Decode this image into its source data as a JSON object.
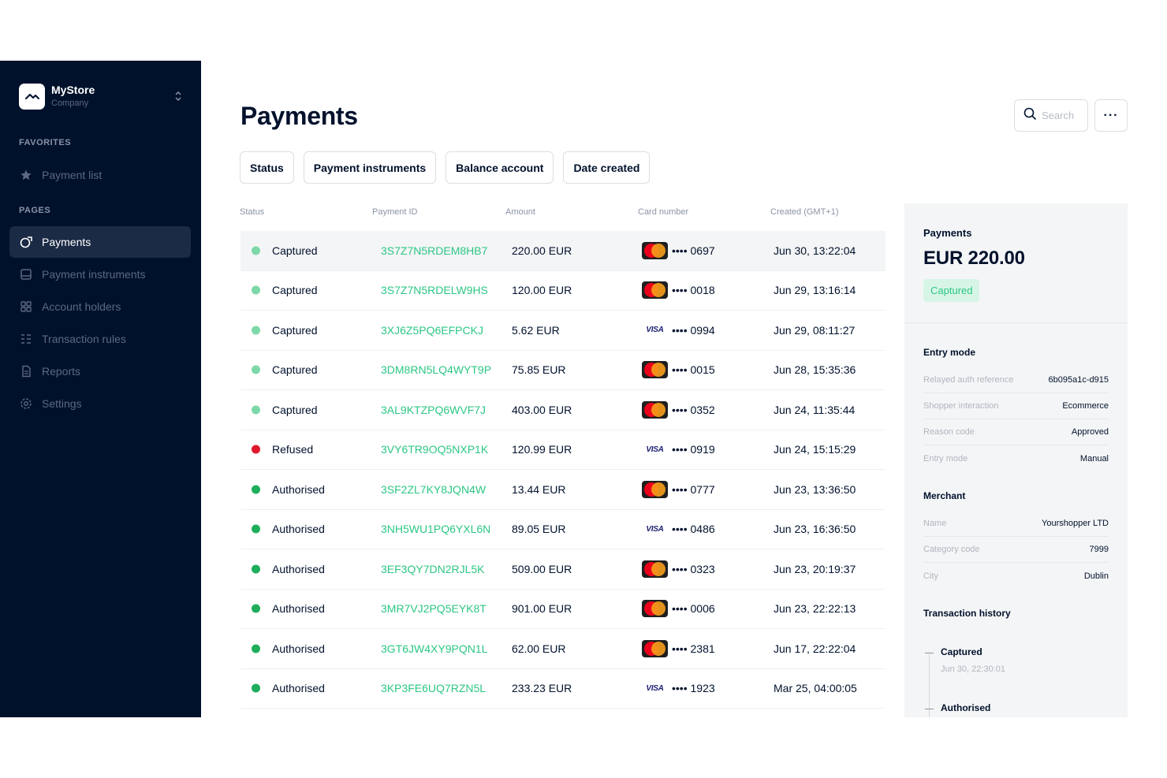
{
  "store": {
    "name": "MyStore",
    "subtitle": "Company"
  },
  "sidebar": {
    "favorites_label": "FAVORITES",
    "favorites": [
      {
        "label": "Payment list",
        "icon": "star-icon"
      }
    ],
    "pages_label": "PAGES",
    "pages": [
      {
        "label": "Payments",
        "icon": "payments-icon",
        "active": true
      },
      {
        "label": "Payment instruments",
        "icon": "card-icon"
      },
      {
        "label": "Account holders",
        "icon": "grid-icon"
      },
      {
        "label": "Transaction rules",
        "icon": "rules-icon"
      },
      {
        "label": "Reports",
        "icon": "document-icon"
      },
      {
        "label": "Settings",
        "icon": "gear-icon"
      }
    ]
  },
  "header": {
    "title": "Payments",
    "search_placeholder": "Search",
    "more_label": "···"
  },
  "filters": [
    "Status",
    "Payment instruments",
    "Balance account",
    "Date created"
  ],
  "table": {
    "columns": [
      "Status",
      "Payment ID",
      "Amount",
      "Card number",
      "Created (GMT+1)"
    ],
    "rows": [
      {
        "status": "Captured",
        "id": "3S7Z7N5RDEM8HB7",
        "amount": "220.00 EUR",
        "brand": "mastercard",
        "card": "•••• 0697",
        "created": "Jun 30, 13:22:04",
        "selected": true
      },
      {
        "status": "Captured",
        "id": "3S7Z7N5RDELW9HS",
        "amount": "120.00 EUR",
        "brand": "mastercard",
        "card": "•••• 0018",
        "created": "Jun 29, 13:16:14"
      },
      {
        "status": "Captured",
        "id": "3XJ6Z5PQ6EFPCKJ",
        "amount": "5.62 EUR",
        "brand": "visa",
        "card": "•••• 0994",
        "created": "Jun 29, 08:11:27"
      },
      {
        "status": "Captured",
        "id": "3DM8RN5LQ4WYT9P",
        "amount": "75.85 EUR",
        "brand": "mastercard",
        "card": "•••• 0015",
        "created": "Jun 28, 15:35:36"
      },
      {
        "status": "Captured",
        "id": "3AL9KTZPQ6WVF7J",
        "amount": "403.00 EUR",
        "brand": "mastercard",
        "card": "•••• 0352",
        "created": "Jun 24, 11:35:44"
      },
      {
        "status": "Refused",
        "id": "3VY6TR9OQ5NXP1K",
        "amount": "120.99 EUR",
        "brand": "visa",
        "card": "•••• 0919",
        "created": "Jun 24, 15:15:29"
      },
      {
        "status": "Authorised",
        "id": "3SF2ZL7KY8JQN4W",
        "amount": "13.44 EUR",
        "brand": "mastercard",
        "card": "•••• 0777",
        "created": "Jun 23, 13:36:50"
      },
      {
        "status": "Authorised",
        "id": "3NH5WU1PQ6YXL6N",
        "amount": "89.05 EUR",
        "brand": "visa",
        "card": "•••• 0486",
        "created": "Jun 23, 16:36:50"
      },
      {
        "status": "Authorised",
        "id": "3EF3QY7DN2RJL5K",
        "amount": "509.00 EUR",
        "brand": "mastercard",
        "card": "•••• 0323",
        "created": "Jun 23, 20:19:37"
      },
      {
        "status": "Authorised",
        "id": "3MR7VJ2PQ5EYK8T",
        "amount": "901.00 EUR",
        "brand": "mastercard",
        "card": "•••• 0006",
        "created": "Jun 23, 22:22:13"
      },
      {
        "status": "Authorised",
        "id": "3GT6JW4XY9PQN1L",
        "amount": "62.00 EUR",
        "brand": "mastercard",
        "card": "•••• 2381",
        "created": "Jun 17, 22:22:04"
      },
      {
        "status": "Authorised",
        "id": "3KP3FE6UQ7RZN5L",
        "amount": "233.23 EUR",
        "brand": "visa",
        "card": "•••• 1923",
        "created": "Mar 25, 04:00:05"
      }
    ]
  },
  "status_colors": {
    "Captured": "#7dd8a8",
    "Refused": "#e0182d",
    "Authorised": "#1fae5b"
  },
  "detail": {
    "label": "Payments",
    "amount": "EUR 220.00",
    "status": "Captured",
    "entry_mode": {
      "title": "Entry mode",
      "rows": [
        {
          "key": "Relayed auth reference",
          "value": "6b095a1c-d915"
        },
        {
          "key": "Shopper interaction",
          "value": "Ecommerce"
        },
        {
          "key": "Reason code",
          "value": "Approved"
        },
        {
          "key": "Entry mode",
          "value": "Manual"
        }
      ]
    },
    "merchant": {
      "title": "Merchant",
      "rows": [
        {
          "key": "Name",
          "value": "Yourshopper LTD"
        },
        {
          "key": "Category code",
          "value": "7999"
        },
        {
          "key": "City",
          "value": "Dublin"
        }
      ]
    },
    "history": {
      "title": "Transaction history",
      "events": [
        {
          "title": "Captured",
          "time": "Jun 30, 22:30:01"
        },
        {
          "title": "Authorised",
          "time": ""
        }
      ]
    }
  }
}
